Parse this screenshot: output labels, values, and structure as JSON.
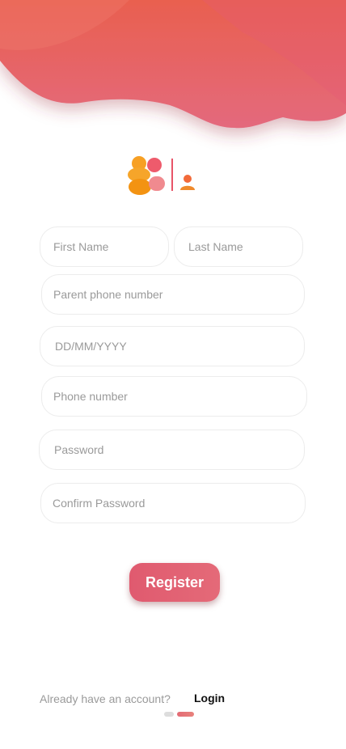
{
  "form": {
    "first_name_placeholder": "First Name",
    "last_name_placeholder": "Last Name",
    "parent_phone_placeholder": "Parent phone number",
    "dob_placeholder": "DD/MM/YYYY",
    "phone_placeholder": "Phone number",
    "password_placeholder": "Password",
    "confirm_password_placeholder": "Confirm Password"
  },
  "actions": {
    "register_label": "Register"
  },
  "footer": {
    "prompt_text": "Already have an account?",
    "login_label": "Login"
  },
  "colors": {
    "header_top": "#e9604f",
    "header_bottom": "#e4697d",
    "button": "#e05a6f",
    "pager_active": "#e36a74",
    "pager_inactive": "#dddddd"
  },
  "pager": {
    "active_index": 1,
    "count": 2
  }
}
